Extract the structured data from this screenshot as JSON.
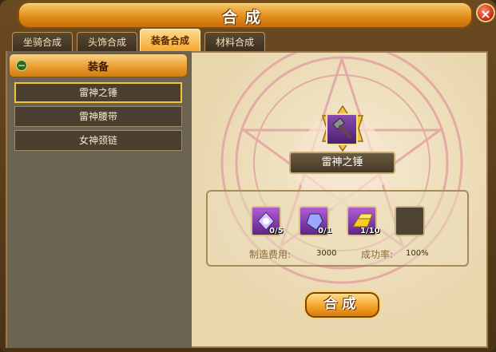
{
  "window": {
    "title": "合成",
    "close_label": "×"
  },
  "tabs": [
    {
      "label": "坐骑合成",
      "active": false
    },
    {
      "label": "头饰合成",
      "active": false
    },
    {
      "label": "装备合成",
      "active": true
    },
    {
      "label": "材料合成",
      "active": false
    }
  ],
  "category": {
    "toggle": "−",
    "label": "装备"
  },
  "items": [
    {
      "label": "雷神之锤",
      "selected": true
    },
    {
      "label": "雷神腰带",
      "selected": false
    },
    {
      "label": "女神颈链",
      "selected": false
    }
  ],
  "product": {
    "name": "雷神之锤",
    "icon": "hammer-icon"
  },
  "materials": [
    {
      "icon": "purple-crystal-icon",
      "count": "0/5"
    },
    {
      "icon": "blue-gem-icon",
      "count": "0/1"
    },
    {
      "icon": "gold-bar-icon",
      "count": "1/10"
    },
    {
      "icon": "empty-slot",
      "count": ""
    }
  ],
  "cost": {
    "label": "制造费用:",
    "value": "3000"
  },
  "success": {
    "label": "成功率:",
    "value": "100%"
  },
  "craft_button": {
    "label": "合成"
  },
  "colors": {
    "accent": "#f0a030",
    "panel": "#e9d8b0",
    "sidebar": "#6d6351",
    "slot": "#7a3fa6"
  }
}
